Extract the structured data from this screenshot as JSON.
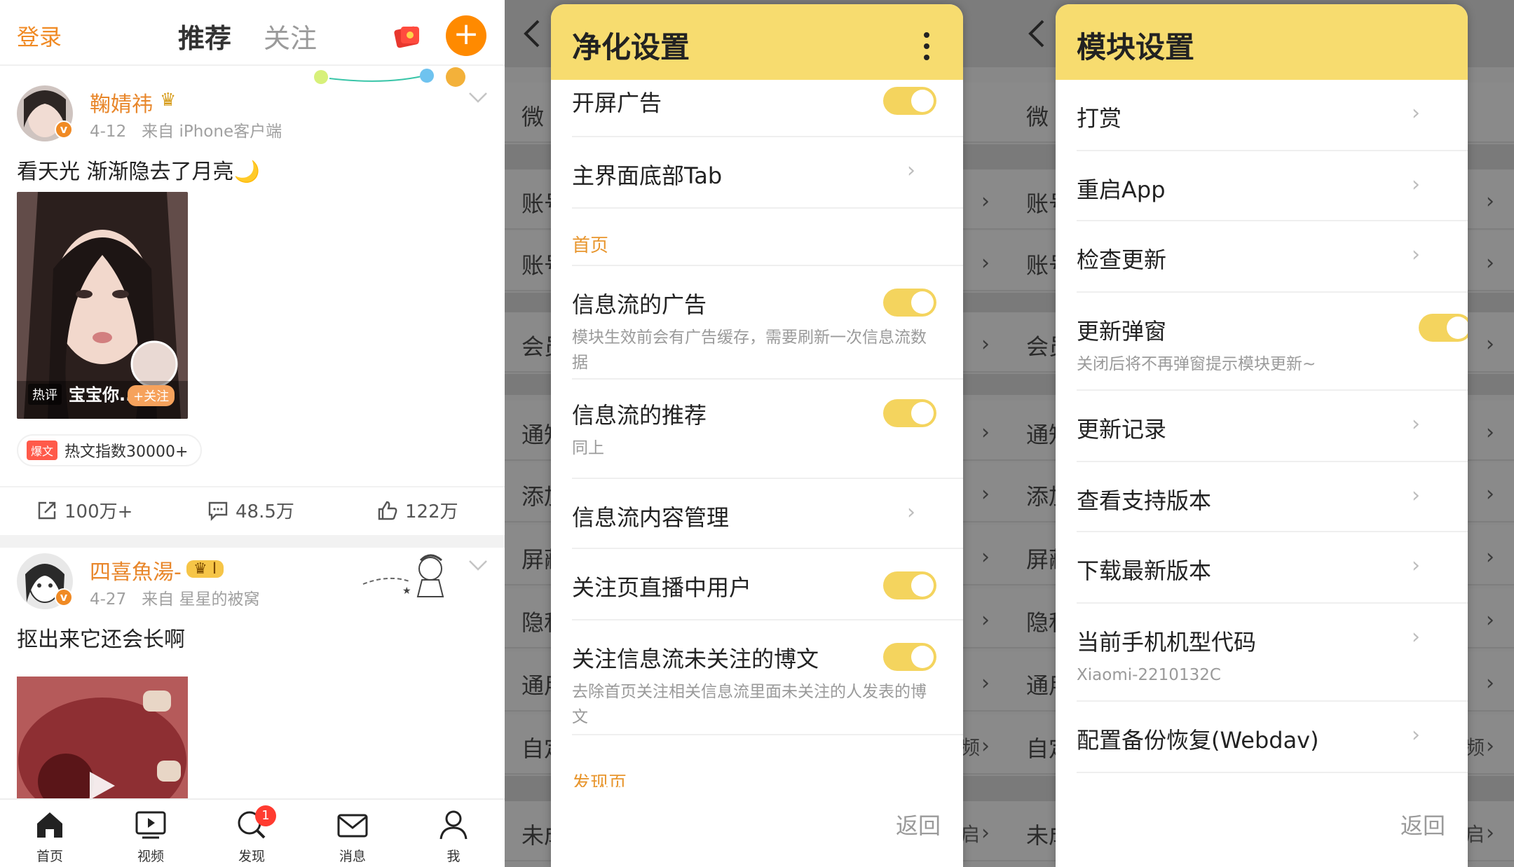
{
  "feed": {
    "header": {
      "login": "登录",
      "tab_recommend": "推荐",
      "tab_follow": "关注",
      "plus": "+"
    },
    "post1": {
      "username": "鞠婧祎",
      "time": "4-12",
      "source": "来自 iPhone客户端",
      "text": "看天光 渐渐隐去了月亮",
      "emoji": "🌙",
      "hot_label": "热评",
      "hot_name": "宝宝你...",
      "follow_chip": "+关注",
      "bw_label": "爆文",
      "hot_index": "热文指数30000+",
      "repost": "100万+",
      "comment": "48.5万",
      "like": "122万"
    },
    "post2": {
      "username": "四喜魚湯-",
      "time": "4-27",
      "source": "来自 星星的被窝",
      "text": "抠出来它还会长啊",
      "level": "I"
    },
    "nav": [
      {
        "label": "首页",
        "icon": "home-icon"
      },
      {
        "label": "视频",
        "icon": "video-icon"
      },
      {
        "label": "发现",
        "icon": "discover-icon",
        "badge": "1"
      },
      {
        "label": "消息",
        "icon": "mail-icon"
      },
      {
        "label": "我",
        "icon": "profile-icon"
      }
    ]
  },
  "bg_settings": {
    "rows": [
      "微",
      "账号",
      "账号",
      "会员",
      "通知",
      "添加",
      "屏蔽",
      "隐私",
      "通用",
      "自定",
      "未成"
    ],
    "right_hint_a": "频",
    "right_hint_b": "启"
  },
  "purify_dialog": {
    "title": "净化设置",
    "row_splash_ad": "开屏广告",
    "row_bottom_tab": "主界面底部Tab",
    "section_home": "首页",
    "row_feed_ad": "信息流的广告",
    "row_feed_ad_sub": "模块生效前会有广告缓存，需要刷新一次信息流数据",
    "row_feed_rec": "信息流的推荐",
    "row_feed_rec_sub": "同上",
    "row_feed_manage": "信息流内容管理",
    "row_live_users": "关注页直播中用户",
    "row_unfollowed_posts": "关注信息流未关注的博文",
    "row_unfollowed_posts_sub": "去除首页关注相关信息流里面未关注的人发表的博文",
    "section_discover": "发现页",
    "back": "返回"
  },
  "module_dialog": {
    "title": "模块设置",
    "row_reward": "打赏",
    "row_restart": "重启App",
    "row_check_update": "检查更新",
    "row_update_popup": "更新弹窗",
    "row_update_popup_sub": "关闭后将不再弹窗提示模块更新~",
    "row_changelog": "更新记录",
    "row_supported": "查看支持版本",
    "row_download": "下载最新版本",
    "row_model_code": "当前手机机型代码",
    "row_model_code_value": "Xiaomi-2210132C",
    "row_backup": "配置备份恢复(Webdav)",
    "back": "返回"
  },
  "colors": {
    "accent_orange": "#f08a24",
    "dialog_header_yellow": "#f7dc6f",
    "toggle_on": "#f4d45e"
  }
}
